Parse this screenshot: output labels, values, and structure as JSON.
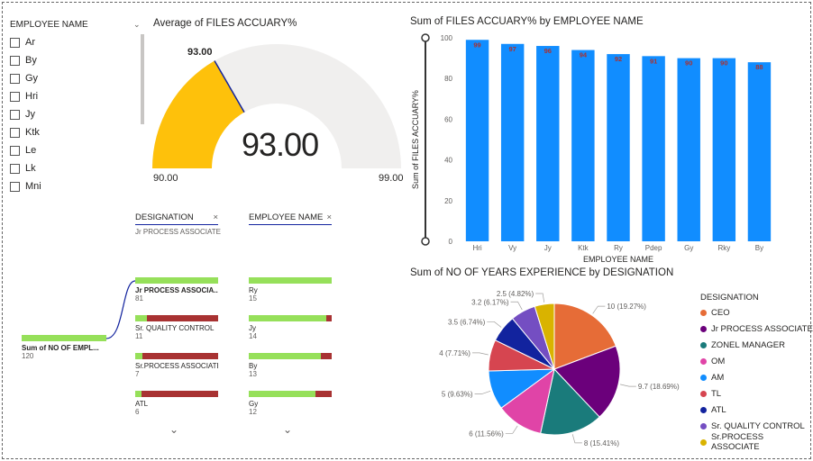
{
  "slicer": {
    "title": "EMPLOYEE NAME",
    "items": [
      "Ar",
      "By",
      "Gy",
      "Hri",
      "Jy",
      "Ktk",
      "Le",
      "Lk",
      "Mni"
    ]
  },
  "gauge": {
    "title": "Average of FILES ACCUARY%",
    "value_label": "93.00",
    "target_label": "93.00",
    "min_label": "90.00",
    "max_label": "99.00",
    "value": 93,
    "min": 90,
    "max": 99,
    "fill_color": "#fec10b",
    "track_color": "#f0efee"
  },
  "decomp": {
    "header1": "DESIGNATION",
    "header1_sub": "Jr PROCESS ASSOCIATE",
    "header2": "EMPLOYEE NAME",
    "root_label": "Sum of NO OF EMPL...",
    "root_value": "120",
    "col1": [
      {
        "label": "Jr PROCESS ASSOCIA...",
        "value": "81",
        "fill": 1.0
      },
      {
        "label": "Sr. QUALITY CONTROL",
        "value": "11",
        "fill": 0.14
      },
      {
        "label": "Sr.PROCESS ASSOCIATE",
        "value": "7",
        "fill": 0.09
      },
      {
        "label": "ATL",
        "value": "6",
        "fill": 0.08
      }
    ],
    "col2": [
      {
        "label": "Ry",
        "value": "15",
        "fill": 1.0
      },
      {
        "label": "Jy",
        "value": "14",
        "fill": 0.93
      },
      {
        "label": "By",
        "value": "13",
        "fill": 0.87
      },
      {
        "label": "Gy",
        "value": "12",
        "fill": 0.8
      }
    ]
  },
  "chart_data": [
    {
      "type": "bar",
      "title": "Sum of FILES ACCUARY% by EMPLOYEE NAME",
      "xlabel": "EMPLOYEE NAME",
      "ylabel": "Sum of FILES ACCUARY%",
      "categories": [
        "Hri",
        "Vy",
        "Jy",
        "Ktk",
        "Ry",
        "Pdep",
        "Gy",
        "Rky",
        "By"
      ],
      "values": [
        99,
        97,
        96,
        94,
        92,
        91,
        90,
        90,
        88
      ],
      "yticks": [
        0,
        20,
        40,
        60,
        80,
        100
      ],
      "ylim": [
        0,
        100
      ],
      "bar_color": "#118dff",
      "label_color": "#a83232"
    },
    {
      "type": "pie",
      "title": "Sum of NO OF YEARS EXPERIENCE by DESIGNATION",
      "legend_title": "DESIGNATION",
      "slices": [
        {
          "name": "CEO",
          "value": 10,
          "label": "10 (19.27%)",
          "color": "#e66c37"
        },
        {
          "name": "Jr PROCESS ASSOCIATE",
          "value": 9.7,
          "label": "9.7 (18.69%)",
          "color": "#6b007b"
        },
        {
          "name": "ZONEL MANAGER",
          "value": 8,
          "label": "8 (15.41%)",
          "color": "#1a7b7b"
        },
        {
          "name": "OM",
          "value": 6,
          "label": "6 (11.56%)",
          "color": "#e044a7"
        },
        {
          "name": "AM",
          "value": 5,
          "label": "5 (9.63%)",
          "color": "#118dff"
        },
        {
          "name": "TL",
          "value": 4,
          "label": "4 (7.71%)",
          "color": "#d64550"
        },
        {
          "name": "ATL",
          "value": 3.5,
          "label": "3.5 (6.74%)",
          "color": "#12239e"
        },
        {
          "name": "Sr. QUALITY CONTROL",
          "value": 3.2,
          "label": "3.2 (6.17%)",
          "color": "#744ec2"
        },
        {
          "name": "Sr.PROCESS ASSOCIATE",
          "value": 2.5,
          "label": "2.5 (4.82%)",
          "color": "#d9b300"
        }
      ]
    }
  ]
}
